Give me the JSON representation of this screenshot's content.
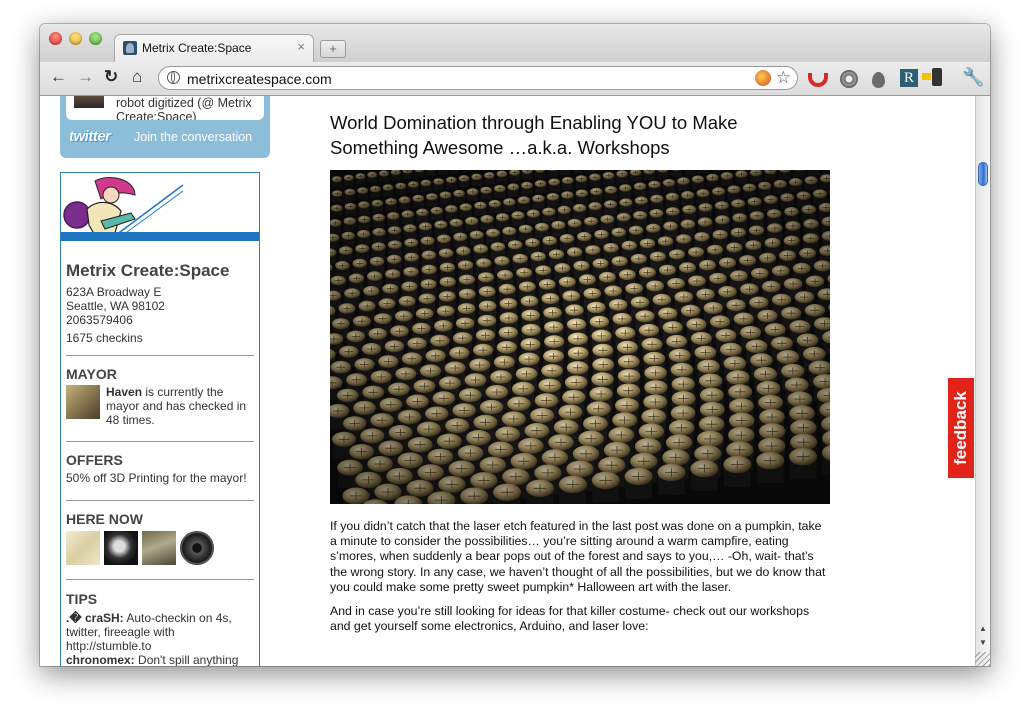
{
  "browser": {
    "tab_title": "Metrix Create:Space",
    "tab_close": "×",
    "new_tab": "+",
    "back": "←",
    "forward": "→",
    "reload": "↻",
    "home": "⌂",
    "url": "metrixcreatespace.com",
    "star": "☆",
    "ext_r": "R",
    "wrench": "🔧"
  },
  "sidebar": {
    "twitter": {
      "tweet_text": "robot digitized (@ Metrix Create:Space)",
      "logo_text": "twitter",
      "cta": "Join the conversation"
    },
    "venue": {
      "name": "Metrix Create:Space",
      "address_line1": "623A Broadway E",
      "address_line2": "Seattle, WA 98102",
      "phone": "2063579406",
      "checkins": "1675 checkins",
      "mayor_heading": "MAYOR",
      "mayor_name": "Haven",
      "mayor_text": " is currently the mayor and has checked in 48 times.",
      "offers_heading": "OFFERS",
      "offer_text": "50% off 3D Printing for the mayor!",
      "here_now_heading": "HERE NOW",
      "tips_heading": "TIPS",
      "tip1_author": ".� craSH:",
      "tip1_text": " Auto-checkin on 4s, twitter, fireeagle with http://stumble.to",
      "tip2_author": "chronomex:",
      "tip2_text": " Don't spill anything"
    }
  },
  "post": {
    "title": "World Domination through Enabling YOU to Make Something Awesome …a.k.a. Workshops",
    "paragraph1": "If you didn’t catch that the laser etch featured in the last post was done on a pumpkin, take a minute to consider the possibilities… you’re sitting around a warm campfire, eating s’mores, when suddenly a bear pops out of the forest and says to you,… -Oh, wait- that’s the wrong story.  In any case, we haven’t thought of all the possibilities, but we do know that you could make some pretty sweet pumpkin* Halloween art with the laser.",
    "paragraph2": "And in case you’re still looking for ideas for that killer costume- check out our workshops and get yourself some electronics, Arduino, and laser love:"
  },
  "feedback": {
    "label": "feedback"
  },
  "colors": {
    "feedback_red": "#e2231a",
    "twitter_blue": "#8cbdd9",
    "foursquare_border": "#2d7fb6"
  }
}
